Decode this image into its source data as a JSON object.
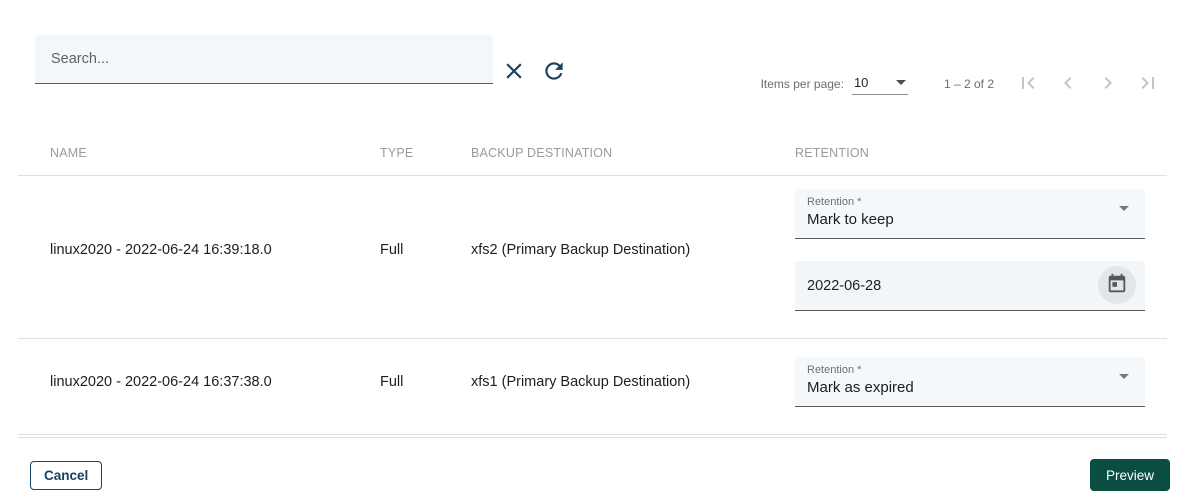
{
  "toolbar": {
    "search_placeholder": "Search...",
    "icons": {
      "clear": "close-icon",
      "reload": "refresh-icon"
    }
  },
  "paginator": {
    "items_per_page_label": "Items per page:",
    "page_size": "10",
    "range_label": "1 – 2 of 2",
    "icons": [
      "first-page-icon",
      "chevron-left-icon",
      "chevron-right-icon",
      "last-page-icon"
    ]
  },
  "table": {
    "columns": [
      "NAME",
      "TYPE",
      "BACKUP DESTINATION",
      "RETENTION"
    ],
    "rows": [
      {
        "name": "linux2020 - 2022-06-24 16:39:18.0",
        "type": "Full",
        "backup_destination": "xfs2 (Primary Backup Destination)",
        "retention": {
          "label": "Retention *",
          "value": "Mark to keep",
          "date": "2022-06-28",
          "date_icon": "calendar-icon"
        }
      },
      {
        "name": "linux2020 - 2022-06-24 16:37:38.0",
        "type": "Full",
        "backup_destination": "xfs1 (Primary Backup Destination)",
        "retention": {
          "label": "Retention *",
          "value": "Mark as expired"
        }
      }
    ]
  },
  "footer": {
    "cancel_label": "Cancel",
    "preview_label": "Preview"
  },
  "colors": {
    "accent_navy": "#17415e",
    "primary_green": "#0a4e41",
    "field_background": "#f4f7fa",
    "divider": "#e0e0e0",
    "header_text": "#9b9b9b",
    "disabled_icon": "#c4c4c4"
  }
}
